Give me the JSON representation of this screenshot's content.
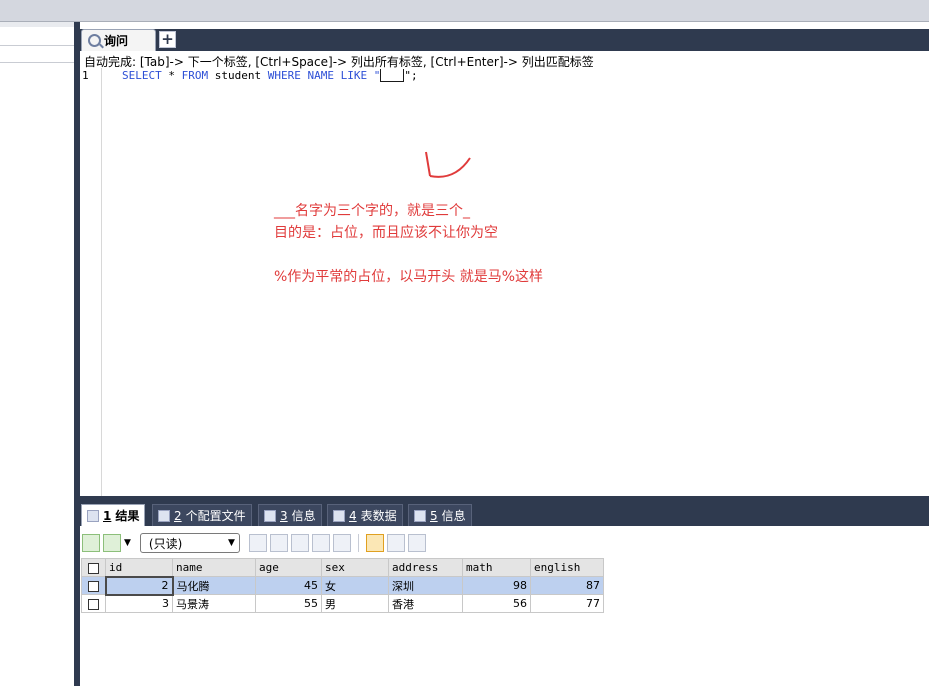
{
  "editor": {
    "tab_label": "询问",
    "add_tab_label": "+",
    "autocomplete_hint": "自动完成: [Tab]-> 下一个标签, [Ctrl+Space]-> 列出所有标签, [Ctrl+Enter]-> 列出匹配标签",
    "line_number": "1",
    "sql": {
      "select": "SELECT",
      "star": "*",
      "from": "FROM",
      "table": "student",
      "where": "WHERE",
      "column": "NAME",
      "like": "LIKE",
      "quote_open": "\"",
      "quote_close": "\";"
    }
  },
  "notes": {
    "line1": "___名字为三个字的，就是三个_",
    "line2": "目的是：占位，而且应该不让你为空",
    "line3": "%作为平常的占位，以马开头 就是马%这样"
  },
  "results": {
    "tabs": [
      {
        "num": "1",
        "label": "结果",
        "icon": "result-grid-icon"
      },
      {
        "num": "2",
        "label": "个配置文件",
        "icon": "profile-icon"
      },
      {
        "num": "3",
        "label": "信息",
        "icon": "info-icon"
      },
      {
        "num": "4",
        "label": "表数据",
        "icon": "table-data-icon"
      },
      {
        "num": "5",
        "label": "信息",
        "icon": "info-icon"
      }
    ],
    "readonly_label": "(只读)",
    "columns": [
      "id",
      "name",
      "age",
      "sex",
      "address",
      "math",
      "english"
    ],
    "rows": [
      [
        "2",
        "马化腾",
        "45",
        "女",
        "深圳",
        "98",
        "87"
      ],
      [
        "3",
        "马景涛",
        "55",
        "男",
        "香港",
        "56",
        "77"
      ]
    ]
  },
  "colors": {
    "note_red": "#e03b3b",
    "keyword_blue": "#2d4fd6",
    "dark_chrome": "#2f3a4f",
    "row_highlight": "#bdd0ef"
  }
}
